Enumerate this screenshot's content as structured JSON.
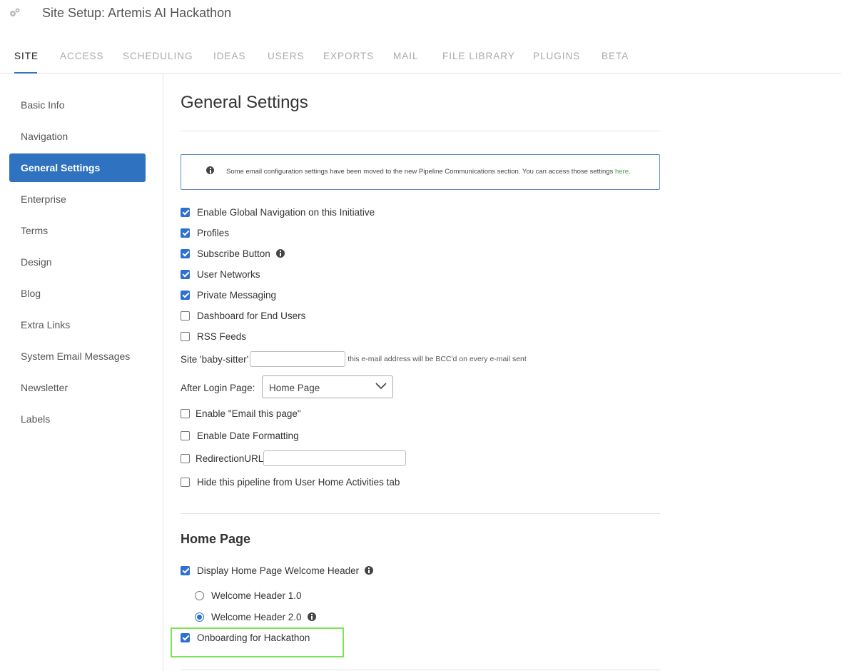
{
  "header": {
    "title": "Site Setup: Artemis AI Hackathon",
    "icon": "gear-icon"
  },
  "tabs": [
    {
      "label": "SITE",
      "active": true
    },
    {
      "label": "ACCESS"
    },
    {
      "label": "SCHEDULING"
    },
    {
      "label": "IDEAS"
    },
    {
      "label": "USERS"
    },
    {
      "label": "EXPORTS"
    },
    {
      "label": "MAIL"
    },
    {
      "label": "FILE LIBRARY"
    },
    {
      "label": "PLUGINS"
    },
    {
      "label": "BETA"
    }
  ],
  "sidebar": {
    "items": [
      {
        "label": "Basic Info"
      },
      {
        "label": "Navigation"
      },
      {
        "label": "General Settings",
        "active": true
      },
      {
        "label": "Enterprise"
      },
      {
        "label": "Terms"
      },
      {
        "label": "Design"
      },
      {
        "label": "Blog"
      },
      {
        "label": "Extra Links"
      },
      {
        "label": "System Email Messages"
      },
      {
        "label": "Newsletter"
      },
      {
        "label": "Labels"
      }
    ]
  },
  "main": {
    "title": "General Settings",
    "notice": {
      "text": "Some email configuration settings have been moved to the new Pipeline Communications section. You can access those settings ",
      "link": "here",
      "suffix": "."
    },
    "options": {
      "global_nav": {
        "label": "Enable Global Navigation on this Initiative",
        "checked": true
      },
      "profiles": {
        "label": "Profiles",
        "checked": true
      },
      "subscribe": {
        "label": "Subscribe Button",
        "checked": true
      },
      "networks": {
        "label": "User Networks",
        "checked": true
      },
      "messaging": {
        "label": "Private Messaging",
        "checked": true
      },
      "dashboard": {
        "label": "Dashboard for End Users",
        "checked": false
      },
      "rss": {
        "label": "RSS Feeds",
        "checked": false
      }
    },
    "babysitter": {
      "label": "Site 'baby-sitter'",
      "value": "",
      "hint": "this e-mail address will be BCC'd on every e-mail sent"
    },
    "after_login": {
      "label": "After Login Page:",
      "value": "Home Page"
    },
    "options2": {
      "email_page": {
        "label": "Enable \"Email this page\"",
        "checked": false
      },
      "date_format": {
        "label": "Enable Date Formatting",
        "checked": false
      },
      "redirection": {
        "label": "RedirectionURL",
        "checked": false,
        "value": ""
      },
      "hide_pipeline": {
        "label": "Hide this pipeline from User Home Activities tab",
        "checked": false
      }
    },
    "home_page": {
      "title": "Home Page",
      "welcome_header": {
        "label": "Display Home Page Welcome Header",
        "checked": true
      },
      "radios": [
        {
          "label": "Welcome Header 1.0",
          "checked": false
        },
        {
          "label": "Welcome Header 2.0",
          "checked": true
        }
      ],
      "onboarding": {
        "label": "Onboarding for Hackathon",
        "checked": true
      }
    }
  },
  "colors": {
    "accent": "#2f72bf",
    "checkbox": "#2d6fd3",
    "highlight": "#7ee257",
    "link": "#49a24b"
  }
}
